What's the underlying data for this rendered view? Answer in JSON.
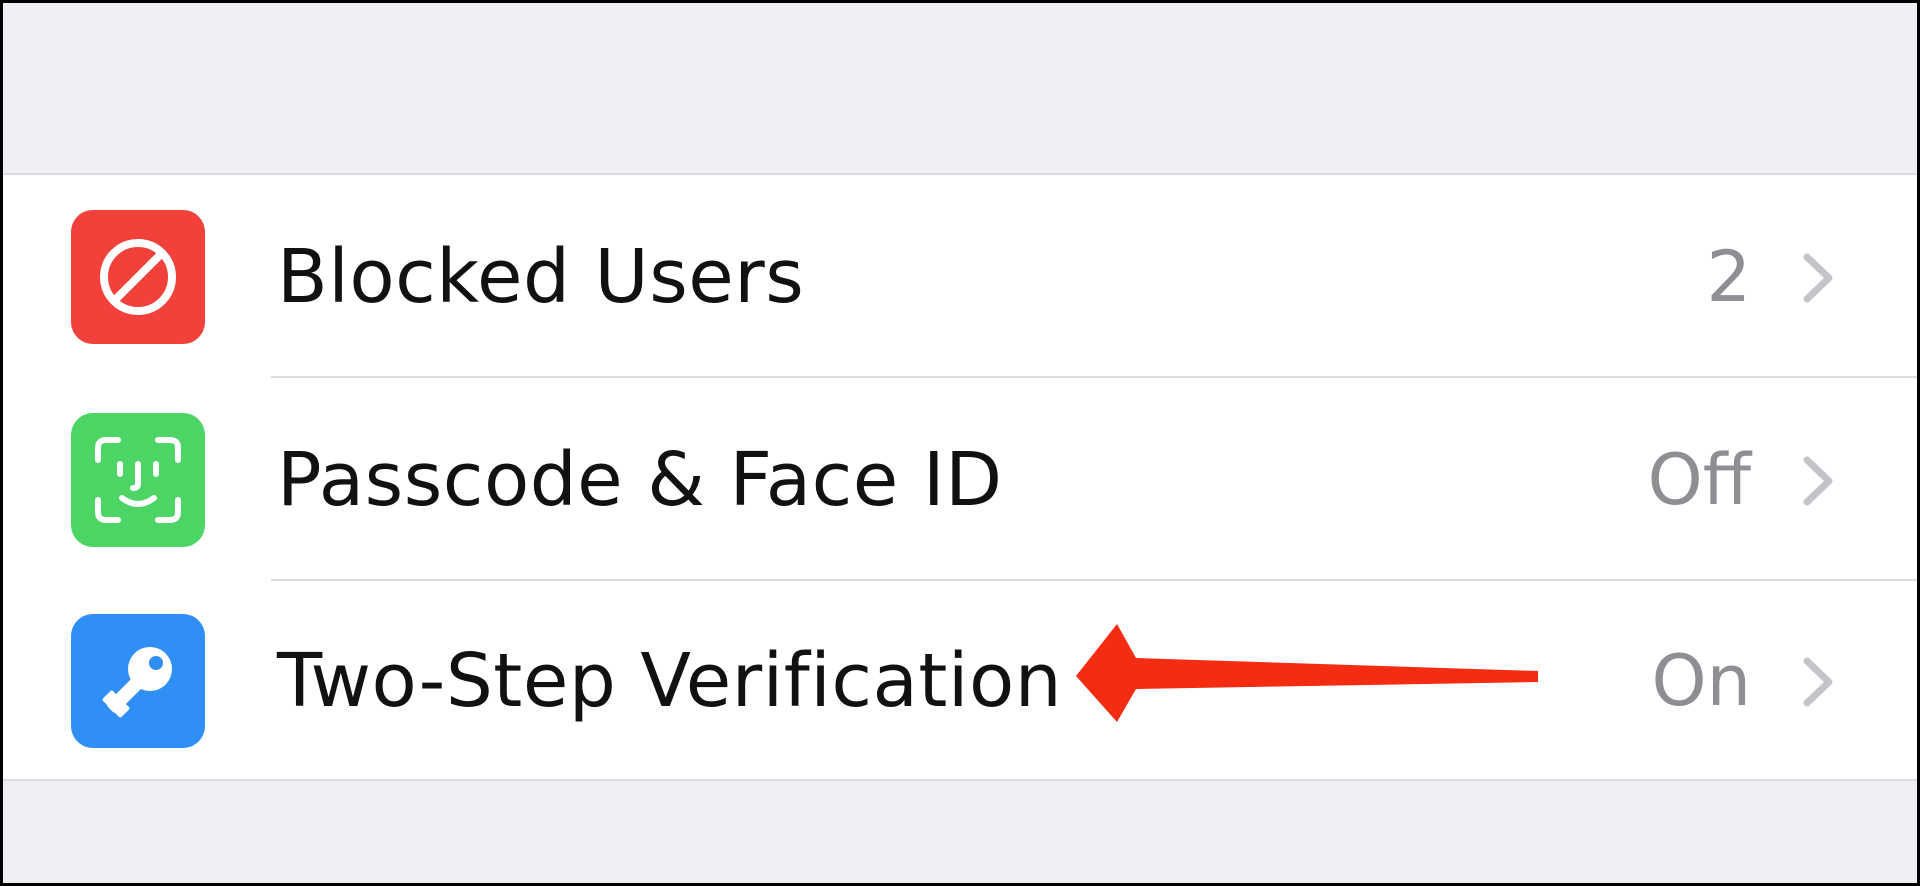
{
  "settings": {
    "items": [
      {
        "label": "Blocked Users",
        "value": "2",
        "icon": "blocked-icon",
        "icon_color": "#f2403a"
      },
      {
        "label": "Passcode & Face ID",
        "value": "Off",
        "icon": "face-id-icon",
        "icon_color": "#4cd464"
      },
      {
        "label": "Two-Step Verification",
        "value": "On",
        "icon": "key-icon",
        "icon_color": "#2f8ff5"
      }
    ]
  },
  "annotation": {
    "arrow_color": "#f42c12",
    "target": "Two-Step Verification"
  },
  "colors": {
    "background": "#efeff4",
    "cell": "#ffffff",
    "separator": "#dcdce0",
    "label": "#111111",
    "detail": "#8e8e93",
    "chevron": "#c4c4c8"
  }
}
